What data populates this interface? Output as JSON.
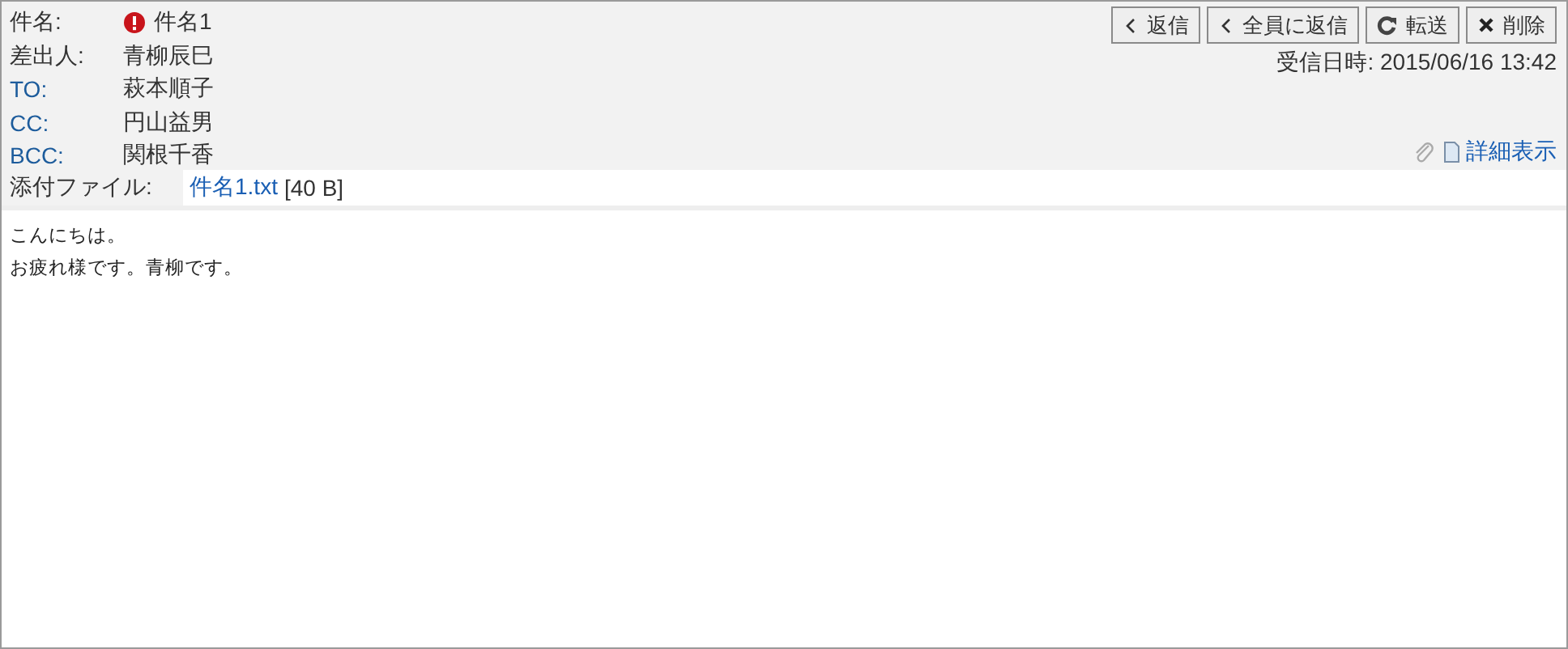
{
  "subject": {
    "label": "件名:",
    "value": "件名1",
    "important": true
  },
  "fields": [
    {
      "kind": "sender",
      "label": "差出人:",
      "value": "青柳辰巳"
    },
    {
      "kind": "recipient",
      "label": "TO:",
      "value": "萩本順子"
    },
    {
      "kind": "recipient",
      "label": "CC:",
      "value": "円山益男"
    },
    {
      "kind": "recipient",
      "label": "BCC:",
      "value": "関根千香"
    }
  ],
  "buttons": [
    {
      "kind": "reply",
      "label": "返信"
    },
    {
      "kind": "reply",
      "label": "全員に返信"
    },
    {
      "kind": "forward",
      "label": "転送"
    },
    {
      "kind": "delete",
      "label": "削除"
    }
  ],
  "received": {
    "label": "受信日時:",
    "value": "2015/06/16 13:42"
  },
  "detail_link": "詳細表示",
  "attachment": {
    "label": "添付ファイル:",
    "file": "件名1.txt",
    "size": "[40 B]"
  },
  "body": [
    "こんにちは。",
    "お疲れ様です。青柳です。"
  ]
}
